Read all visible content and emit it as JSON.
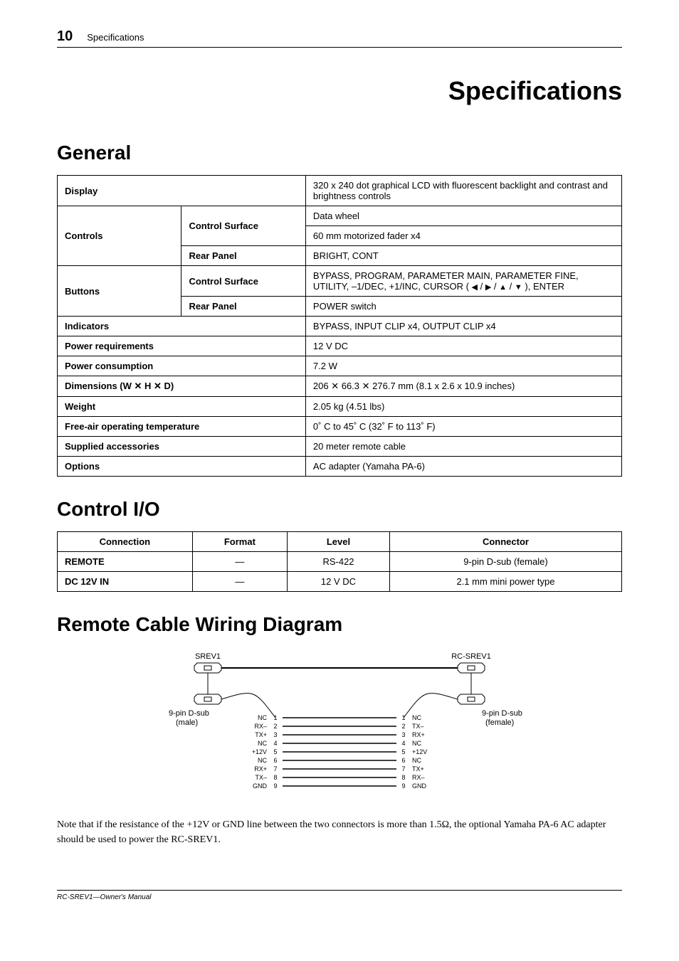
{
  "header": {
    "page_number": "10",
    "section_name": "Specifications"
  },
  "title": "Specifications",
  "general": {
    "heading": "General",
    "rows": [
      {
        "label": "Display",
        "colspan": 2,
        "value": "320 x 240 dot graphical LCD with fluorescent backlight and contrast and brightness controls"
      },
      {
        "label": "Controls",
        "rowspan": 3,
        "sub": "Control Surface",
        "subrowspan": 2,
        "value": "Data wheel"
      },
      {
        "value_only": "60 mm motorized fader x4"
      },
      {
        "sub": "Rear Panel",
        "value": "BRIGHT, CONT"
      },
      {
        "label": "Buttons",
        "rowspan": 2,
        "sub": "Control Surface",
        "value_html": "BYPASS, PROGRAM, PARAMETER MAIN, PARAMETER FINE, UTILITY, –1/DEC, +1/INC, CURSOR ( <span class='triangle'>◀</span> / <span class='triangle'>▶</span> / <span class='triangle'>▲</span> / <span class='triangle'>▼</span> ), ENTER"
      },
      {
        "sub": "Rear Panel",
        "value": "POWER switch"
      },
      {
        "label": "Indicators",
        "colspan": 2,
        "value": "BYPASS, INPUT CLIP x4, OUTPUT CLIP x4"
      },
      {
        "label": "Power requirements",
        "colspan": 2,
        "value": "12 V DC"
      },
      {
        "label": "Power consumption",
        "colspan": 2,
        "value": "7.2 W"
      },
      {
        "label": "Dimensions (W ✕ H ✕ D)",
        "colspan": 2,
        "value": "206 ✕ 66.3 ✕ 276.7 mm (8.1 x 2.6 x 10.9 inches)"
      },
      {
        "label": "Weight",
        "colspan": 2,
        "value": "2.05 kg (4.51 lbs)"
      },
      {
        "label": "Free-air operating temperature",
        "colspan": 2,
        "value": "0˚ C to 45˚ C (32˚ F to 113˚ F)"
      },
      {
        "label": "Supplied accessories",
        "colspan": 2,
        "value": "20 meter remote cable"
      },
      {
        "label": "Options",
        "colspan": 2,
        "value": "AC adapter (Yamaha PA-6)"
      }
    ]
  },
  "control_io": {
    "heading": "Control I/O",
    "columns": [
      "Connection",
      "Format",
      "Level",
      "Connector"
    ],
    "rows": [
      {
        "connection": "REMOTE",
        "format": "—",
        "level": "RS-422",
        "connector": "9-pin D-sub (female)"
      },
      {
        "connection": "DC 12V IN",
        "format": "—",
        "level": "12 V DC",
        "connector": "2.1 mm mini power type"
      }
    ]
  },
  "wiring": {
    "heading": "Remote Cable Wiring Diagram",
    "left_device": "SREV1",
    "right_device": "RC-SREV1",
    "left_conn": "9-pin D-sub\n(male)",
    "right_conn": "9-pin D-sub\n(female)",
    "pins": [
      {
        "n": 1,
        "l": "NC",
        "r": "NC"
      },
      {
        "n": 2,
        "l": "RX–",
        "r": "TX–"
      },
      {
        "n": 3,
        "l": "TX+",
        "r": "RX+"
      },
      {
        "n": 4,
        "l": "NC",
        "r": "NC"
      },
      {
        "n": 5,
        "l": "+12V",
        "r": "+12V"
      },
      {
        "n": 6,
        "l": "NC",
        "r": "NC"
      },
      {
        "n": 7,
        "l": "RX+",
        "r": "TX+"
      },
      {
        "n": 8,
        "l": "TX–",
        "r": "RX–"
      },
      {
        "n": 9,
        "l": "GND",
        "r": "GND"
      }
    ],
    "note": "Note that if the resistance of the +12V or GND line between the two connectors is more than 1.5Ω, the optional Yamaha PA-6 AC adapter should be used to power the RC-SREV1."
  },
  "footer": "RC-SREV1—Owner's Manual"
}
